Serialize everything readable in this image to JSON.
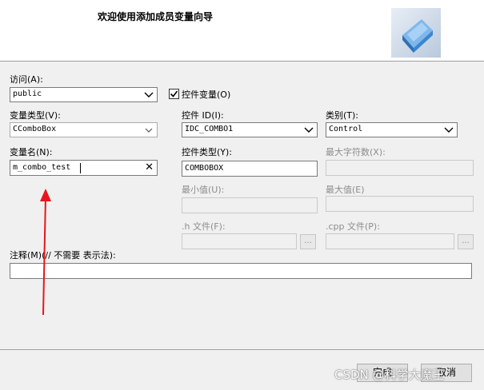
{
  "header": {
    "title": "欢迎使用添加成员变量向导",
    "icon": "wizard-cube-icon"
  },
  "access": {
    "label": "访问(A):",
    "value": "public"
  },
  "control_variable": {
    "label": "控件变量(O)",
    "checked": true
  },
  "variable_type": {
    "label": "变量类型(V):",
    "value": "CComboBox"
  },
  "variable_name": {
    "label": "变量名(N):",
    "value": "m_combo_test",
    "clear_glyph": "✕"
  },
  "control_id": {
    "label": "控件 ID(I):",
    "value": "IDC_COMBO1"
  },
  "category": {
    "label": "类别(T):",
    "value": "Control"
  },
  "control_type": {
    "label": "控件类型(Y):",
    "value": "COMBOBOX"
  },
  "max_chars": {
    "label": "最大字符数(X):",
    "value": ""
  },
  "min_value": {
    "label": "最小值(U):",
    "value": ""
  },
  "max_value": {
    "label": "最大值(E)",
    "value": ""
  },
  "h_file": {
    "label": ".h 文件(F):",
    "value": "",
    "browse": "..."
  },
  "cpp_file": {
    "label": ".cpp 文件(P):",
    "value": "",
    "browse": "..."
  },
  "comment": {
    "label": "注释(M)(// 不需要 表示法):",
    "value": ""
  },
  "buttons": {
    "finish": "完成",
    "cancel": "取消"
  },
  "watermark": "CSDN @科学大魔王",
  "colors": {
    "arrow": "#e8151b",
    "cube": "#3a86d0"
  }
}
